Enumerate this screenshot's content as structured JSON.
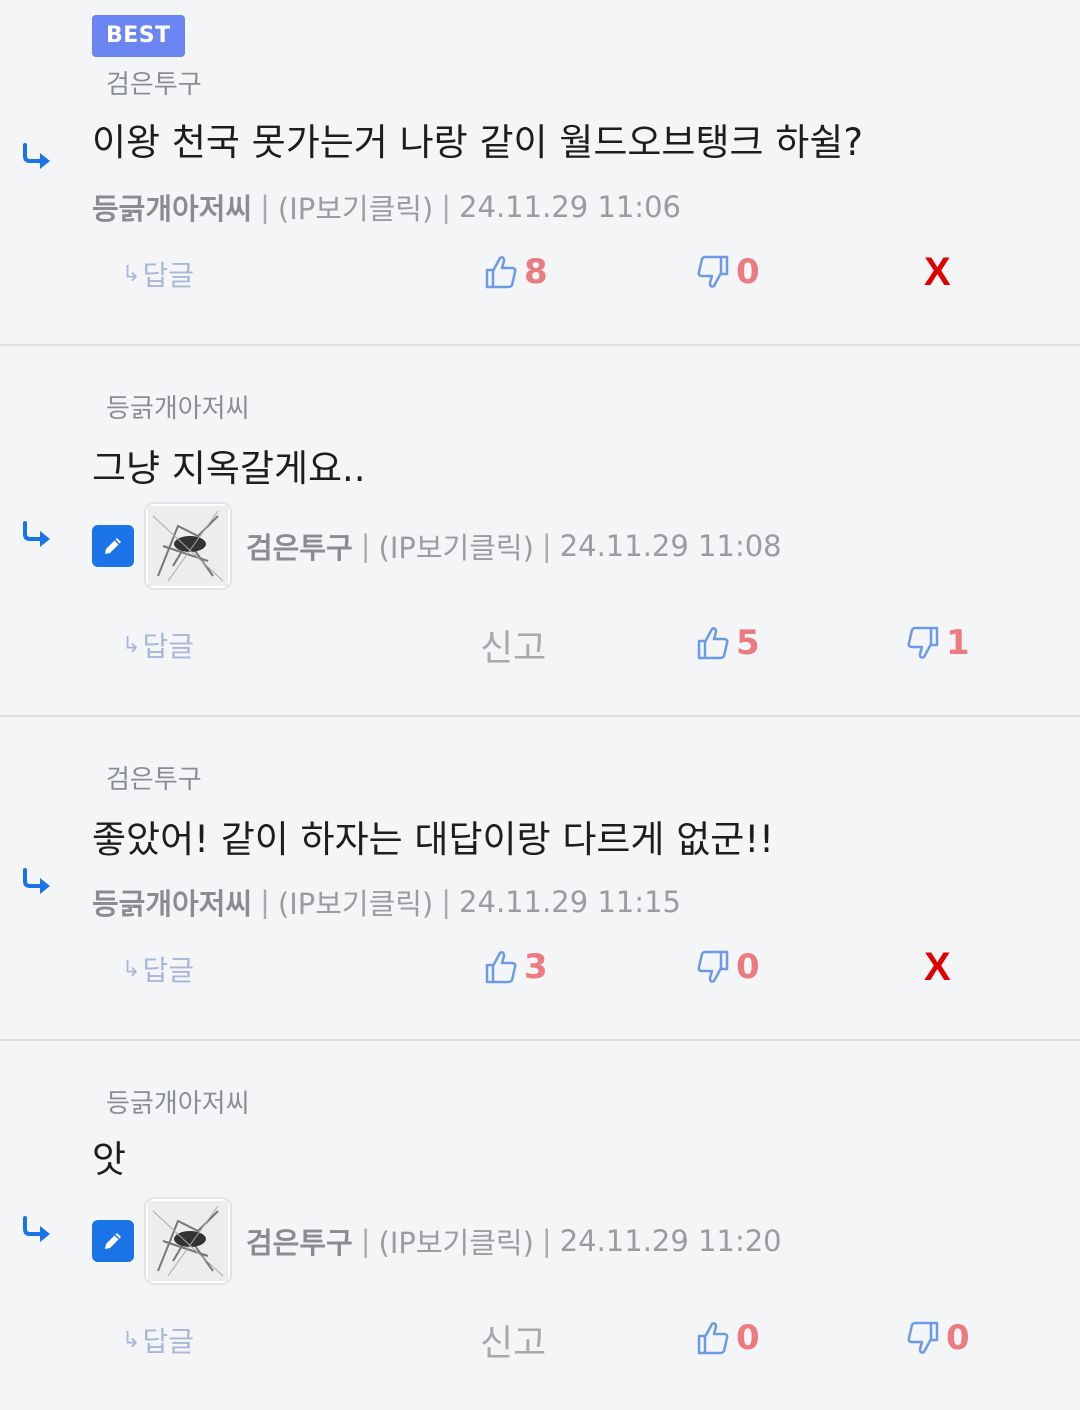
{
  "comments": [
    {
      "badge": "BEST",
      "reply_to": "검은투구",
      "text": "이왕 천국 못가는거 나랑 같이 월드오브탱크 하쉴?",
      "author": "등긁개아저씨",
      "ip_label": "(IP보기클릭)",
      "datetime": "24.11.29 11:06",
      "reply_label": "답글",
      "upvotes": "8",
      "downvotes": "0",
      "delete_label": "X"
    },
    {
      "reply_to": "등긁개아저씨",
      "text": "그냥 지옥갈게요..",
      "author": "검은투구",
      "ip_label": "(IP보기클릭)",
      "datetime": "24.11.29 11:08",
      "reply_label": "답글",
      "report_label": "신고",
      "upvotes": "5",
      "downvotes": "1"
    },
    {
      "reply_to": "검은투구",
      "text": "좋았어! 같이 하자는 대답이랑 다르게 없군!!",
      "author": "등긁개아저씨",
      "ip_label": "(IP보기클릭)",
      "datetime": "24.11.29 11:15",
      "reply_label": "답글",
      "upvotes": "3",
      "downvotes": "0",
      "delete_label": "X"
    },
    {
      "reply_to": "등긁개아저씨",
      "text": "앗",
      "author": "검은투구",
      "ip_label": "(IP보기클릭)",
      "datetime": "24.11.29 11:20",
      "reply_label": "답글",
      "report_label": "신고",
      "upvotes": "0",
      "downvotes": "0"
    }
  ],
  "icons": {
    "reply_arrow": "reply-arrow-icon",
    "thumb_up": "thumbs-up-icon",
    "thumb_down": "thumbs-down-icon",
    "edit": "pencil-icon"
  },
  "colors": {
    "accent_blue": "#1a74e8",
    "badge": "#6b86f2",
    "vote_number": "#ec7b81",
    "delete": "#e00000"
  }
}
